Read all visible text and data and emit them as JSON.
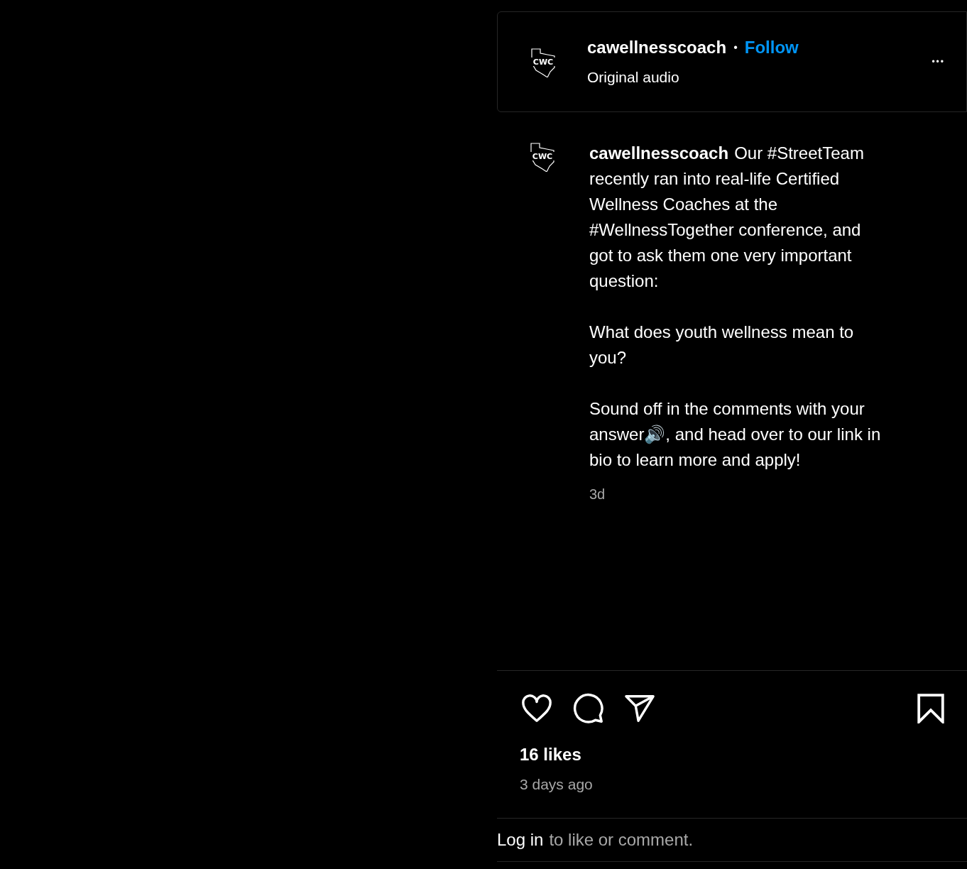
{
  "header": {
    "logo": "CWC",
    "username": "cawellnesscoach",
    "separator": "•",
    "follow": "Follow",
    "audio": "Original audio",
    "more": "•••"
  },
  "caption": {
    "logo": "CWC",
    "username": "cawellnesscoach",
    "paragraphs": [
      "Our #StreetTeam recently ran into real-life Certified Wellness Coaches at the #WellnessTogether conference, and got to ask them one very important question:",
      "What does youth wellness mean to you?",
      "Sound off in the comments with your answer🔊, and head over to our link in bio to learn more and apply!"
    ],
    "age": "3d"
  },
  "likes": "16 likes",
  "posted": "3 days ago",
  "login": {
    "link": "Log in",
    "text": "to like or comment."
  }
}
